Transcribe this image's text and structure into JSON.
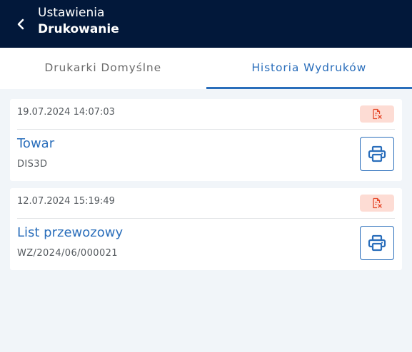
{
  "header": {
    "title": "Ustawienia",
    "subtitle": "Drukowanie"
  },
  "tabs": [
    {
      "label": "Drukarki Domyślne",
      "active": false
    },
    {
      "label": "Historia Wydruków",
      "active": true
    }
  ],
  "history": [
    {
      "datetime": "19.07.2024 14:07:03",
      "title": "Towar",
      "code": "DIS3D",
      "badge_icon": "document-error-icon",
      "action_icon": "printer-icon"
    },
    {
      "datetime": "12.07.2024 15:19:49",
      "title": "List przewozowy",
      "code": "WZ/2024/06/000021",
      "badge_icon": "document-error-icon",
      "action_icon": "printer-icon"
    }
  ],
  "colors": {
    "header_bg": "#02183a",
    "accent": "#2a6ebb",
    "badge_bg": "#fddcd4",
    "badge_icon": "#e5492b",
    "page_bg": "#f1f5f9"
  }
}
